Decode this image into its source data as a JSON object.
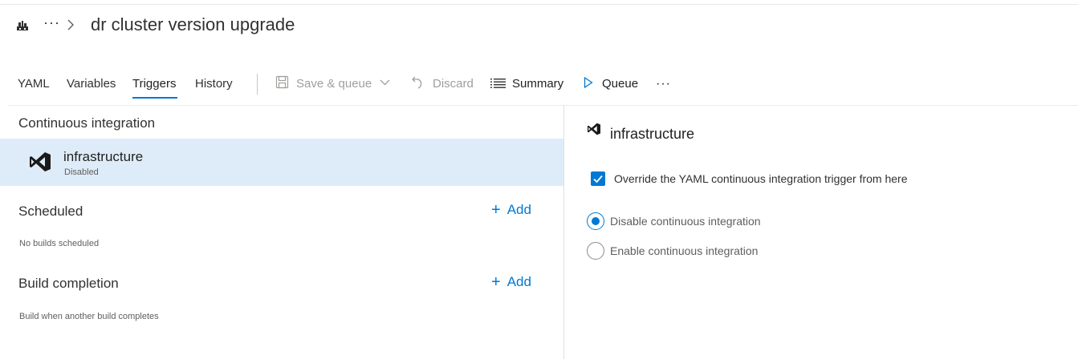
{
  "header": {
    "more_label": "···",
    "title": "dr cluster version upgrade"
  },
  "tabs": [
    {
      "label": "YAML"
    },
    {
      "label": "Variables"
    },
    {
      "label": "Triggers",
      "selected": true
    },
    {
      "label": "History"
    }
  ],
  "commands": {
    "save_queue": "Save & queue",
    "discard": "Discard",
    "summary": "Summary",
    "queue": "Queue",
    "more": "···"
  },
  "left": {
    "ci_title": "Continuous integration",
    "ci_item": {
      "name": "infrastructure",
      "status": "Disabled",
      "icon": "visual-studio-icon"
    },
    "scheduled_title": "Scheduled",
    "scheduled_add": "Add",
    "scheduled_note": "No builds scheduled",
    "completion_title": "Build completion",
    "completion_add": "Add",
    "completion_note": "Build when another build completes"
  },
  "right": {
    "title": "infrastructure",
    "override_label": "Override the YAML continuous integration trigger from here",
    "override_checked": true,
    "options": [
      {
        "label": "Disable continuous integration",
        "checked": true
      },
      {
        "label": "Enable continuous integration",
        "checked": false
      }
    ]
  },
  "colors": {
    "accent": "#0078d4",
    "selected_row": "#deecf9",
    "disabled_text": "#a19f9d"
  }
}
